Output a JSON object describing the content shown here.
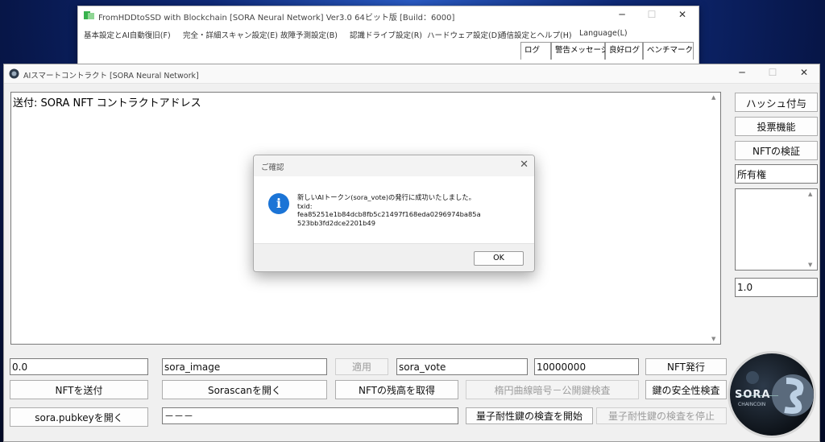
{
  "back_window": {
    "title": "FromHDDtoSSD with Blockchain [SORA Neural Network] Ver3.0 64ビット版 [Build：6000]",
    "menu": [
      "基本設定とAI自動復旧(F)",
      "完全・詳細スキャン設定(E)",
      "故障予測設定(B)",
      "認識ドライブ設定(R)",
      "ハードウェア設定(D)",
      "通信設定とヘルプ(H)",
      "Language(L)"
    ],
    "tabs": [
      "ログ",
      "警告メッセージ",
      "良好ログ",
      "ベンチマーク"
    ]
  },
  "main_window": {
    "title": "AIスマートコントラクト [SORA Neural Network]",
    "text_area": "送付: SORA NFT コントラクトアドレス",
    "side": {
      "hash_button": "ハッシュ付与",
      "vote_button": "投票機能",
      "verify_button": "NFTの検証",
      "ownership_field": "所有権",
      "value_field": "1.0"
    },
    "row1": {
      "amount_field": "0.0",
      "image_field": "sora_image",
      "apply_button": "適用",
      "vote_field": "sora_vote",
      "supply_field": "10000000",
      "issue_button": "NFT発行"
    },
    "row2": {
      "send_button": "NFTを送付",
      "sorascan_button": "Sorascanを開く",
      "balance_button": "NFTの残高を取得",
      "ecc_button": "楕円曲線暗号－公開鍵検査",
      "key_safety_button": "鍵の安全性検査"
    },
    "row3": {
      "pubkey_button": "sora.pubkeyを開く",
      "dash_field": "－－－",
      "quantum_start_button": "量子耐性鍵の検査を開始",
      "quantum_stop_button": "量子耐性鍵の検査を停止"
    }
  },
  "dialog": {
    "title": "ご確認",
    "line1": "新しいAIトークン(sora_vote)の発行に成功いたしました。",
    "line2": "txid:",
    "line3": "fea85251e1b84dcb8fb5c21497f168eda0296974ba85a523bb3fd2dce2201b49",
    "ok_button": "OK"
  },
  "logo": {
    "text_top": "SORA",
    "text_bottom": "CHAINCOIN"
  },
  "colors": {
    "accent": "#1b74d6",
    "app_icon_green": "#37b24d"
  }
}
